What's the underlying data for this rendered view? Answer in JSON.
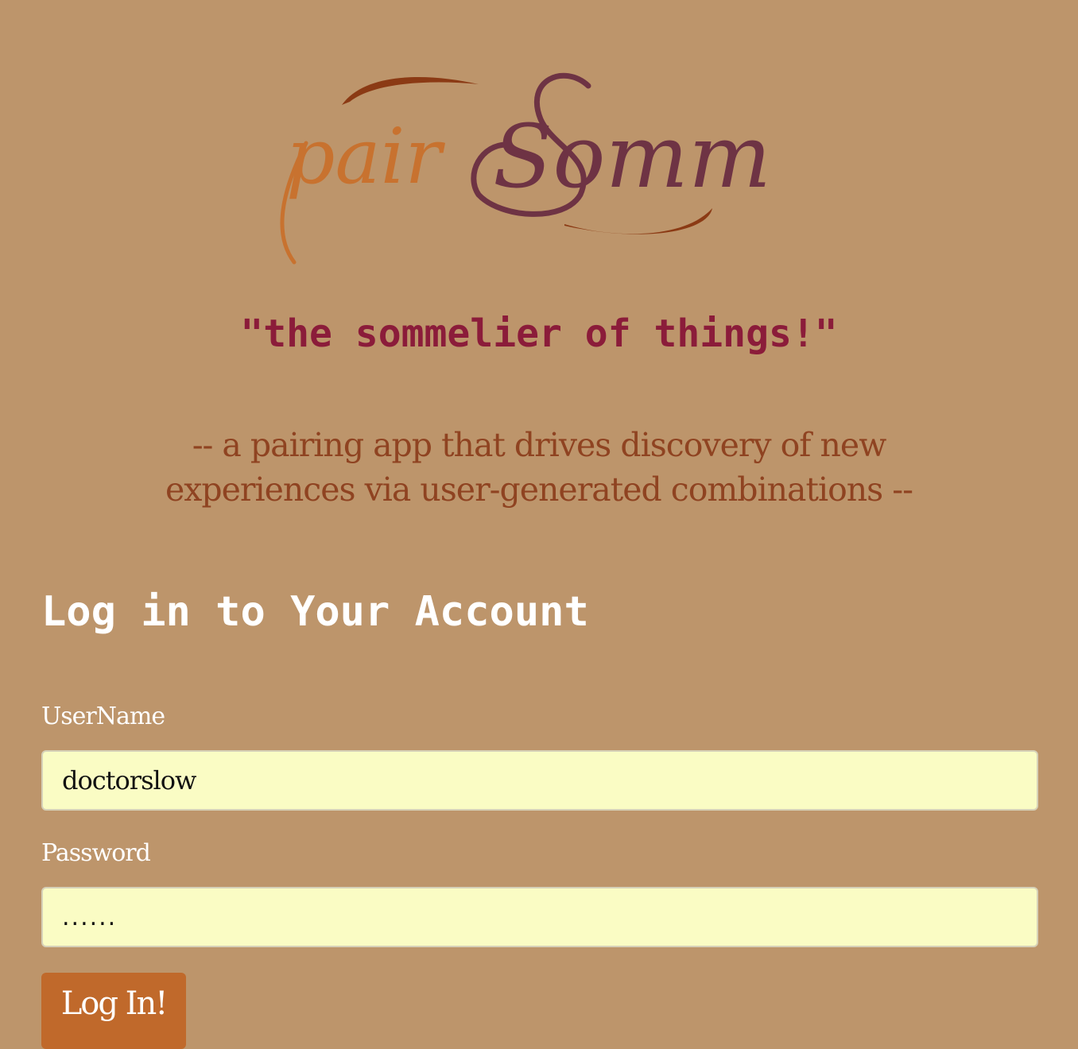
{
  "logo": {
    "part1": "pair",
    "part2": "Somm",
    "colors": {
      "pair": "#c8722f",
      "somm": "#6e3344",
      "swoosh": "#8b3a14"
    }
  },
  "tagline": "\"the sommelier of things!\"",
  "description": "-- a pairing app that drives discovery of new experiences via user-generated combinations --",
  "login": {
    "title": "Log in to Your Account",
    "username_label": "UserName",
    "username_value": "doctorslow",
    "password_label": "Password",
    "password_value": "......",
    "submit_label": "Log In!"
  },
  "colors": {
    "background": "#bd956b",
    "tagline": "#8b1c3a",
    "description": "#8f4321",
    "input_bg": "#fafcc4",
    "button_bg": "#c0692b"
  }
}
